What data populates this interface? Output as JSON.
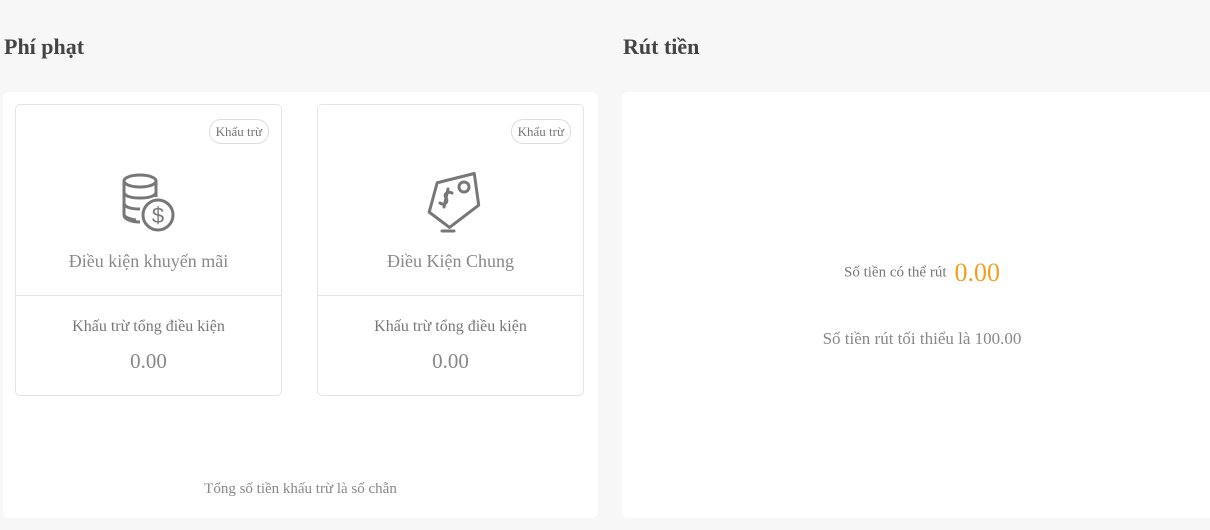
{
  "penalty": {
    "title": "Phí phạt",
    "cards": [
      {
        "badge": "Khấu trừ",
        "icon": "coins-dollar-icon",
        "name": "Điều kiện khuyến mãi",
        "deduct_label": "Khấu trừ tổng điều kiện",
        "deduct_value": "0.00"
      },
      {
        "badge": "Khấu trừ",
        "icon": "price-tag-icon",
        "name": "Điều Kiện Chung",
        "deduct_label": "Khấu trừ tổng điều kiện",
        "deduct_value": "0.00"
      }
    ],
    "total_note": "Tổng số tiền khấu trừ là số chẵn"
  },
  "withdraw": {
    "title": "Rút tiền",
    "available_label": "Số tiền có thể rút",
    "available_value": "0.00",
    "min_note": "Số tiền rút tối thiểu là 100.00"
  },
  "colors": {
    "page_bg": "#f7f7f7",
    "panel_bg": "#ffffff",
    "accent_amount": "#f0a020",
    "icon_gray": "#777777"
  }
}
